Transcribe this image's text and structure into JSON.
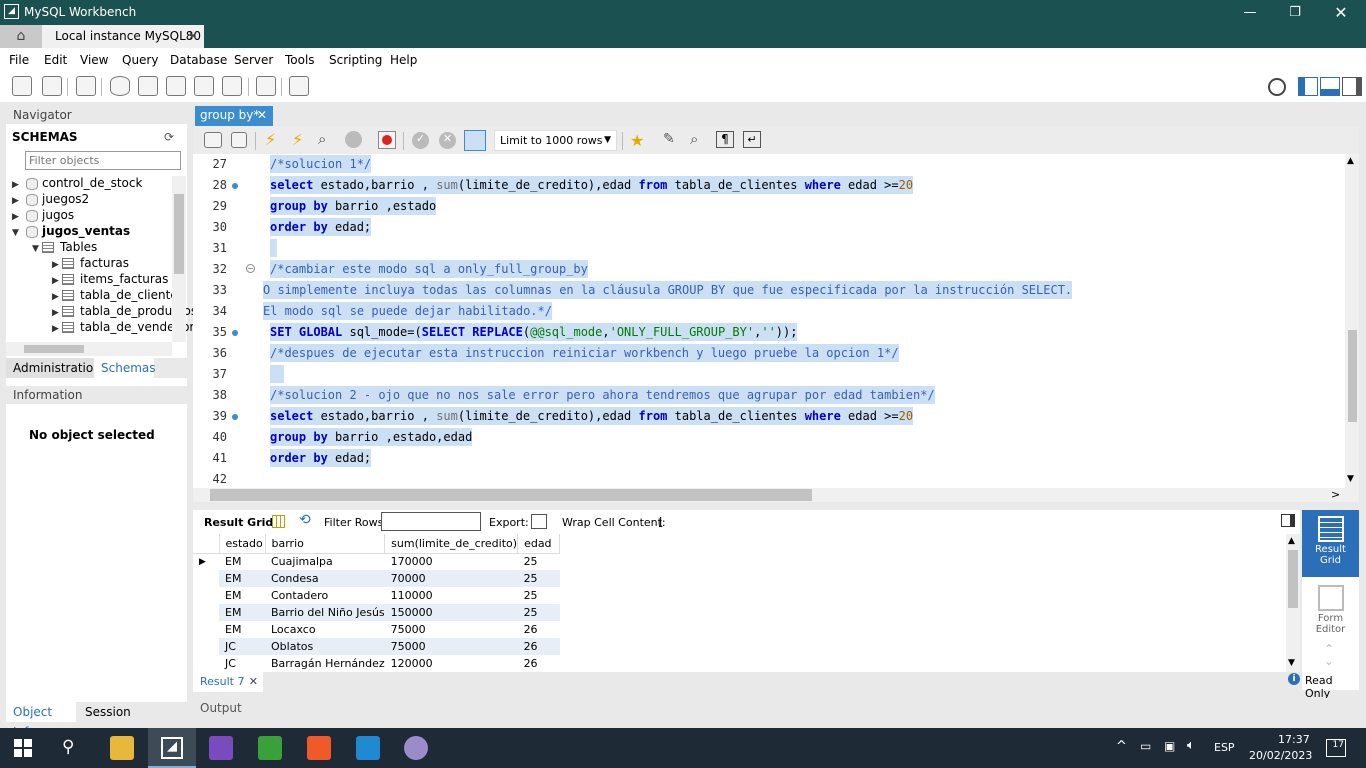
{
  "window": {
    "title": "MySQL Workbench",
    "tab": "Local instance MySQL80"
  },
  "menu": [
    "File",
    "Edit",
    "View",
    "Query",
    "Database",
    "Server",
    "Tools",
    "Scripting",
    "Help"
  ],
  "navigator": {
    "title": "Navigator",
    "schemas_label": "SCHEMAS",
    "filter_placeholder": "Filter objects",
    "schemas": [
      "control_de_stock",
      "juegos2",
      "jugos",
      "jugos_ventas"
    ],
    "tables_label": "Tables",
    "tables": [
      "facturas",
      "items_facturas",
      "tabla_de_clientes",
      "tabla_de_productos",
      "tabla_de_vendedores"
    ],
    "tab_admin": "Administration",
    "tab_schemas": "Schemas",
    "info_title": "Information",
    "no_object": "No object selected",
    "tab_objinfo": "Object Info",
    "tab_session": "Session"
  },
  "editor": {
    "tab": "group by*",
    "limit": "Limit to 1000 rows",
    "lines": [
      {
        "n": "27",
        "html": "<span class='cm'>/*solucion 1*/</span>"
      },
      {
        "n": "28",
        "dot": true,
        "html": "<span class='kw'>select</span> estado,barrio , <span class='fn'>sum</span>(limite_de_credito),edad <span class='kw'>from</span> tabla_de_clientes <span class='kw'>where</span> edad &gt;=<span class='num'>20</span>"
      },
      {
        "n": "29",
        "html": "<span class='kw'>group by</span> barrio ,estado"
      },
      {
        "n": "30",
        "html": "<span class='kw'>order by</span> edad;"
      },
      {
        "n": "31",
        "html": " "
      },
      {
        "n": "32",
        "html": "<span class='cm'>/*cambiar este modo sql a only_full_group_by</span>"
      },
      {
        "n": "33",
        "html": "<span class='cm'>O simplemente incluya todas las columnas en la cláusula GROUP BY que fue especificada por la instrucción SELECT.</span>",
        "indent": -7
      },
      {
        "n": "34",
        "html": "<span class='cm'>El modo sql se puede dejar habilitado.*/</span>",
        "indent": -7
      },
      {
        "n": "35",
        "dot": true,
        "html": "<span class='kw'>SET GLOBAL</span> sql_mode=(<span class='kw'>SELECT REPLACE</span>(<span class='str'>@@sql_mode</span>,<span class='str'>'ONLY_FULL_GROUP_BY'</span>,<span class='str'>''</span>));"
      },
      {
        "n": "36",
        "html": "<span class='cm'>/*despues de ejecutar esta instruccion reiniciar workbench y luego pruebe la opcion 1*/</span>"
      },
      {
        "n": "37",
        "html": "  "
      },
      {
        "n": "38",
        "html": "<span class='cm'>/*solucion 2 - ojo que no nos sale error pero ahora tendremos que agrupar por edad tambien*/</span>"
      },
      {
        "n": "39",
        "dot": true,
        "html": "<span class='kw'>select</span> estado,barrio , <span class='fn'>sum</span>(limite_de_credito),edad <span class='kw'>from</span> tabla_de_clientes <span class='kw'>where</span> edad &gt;=<span class='num'>20</span>"
      },
      {
        "n": "40",
        "html": "<span class='kw'>group by</span> barrio ,estado,edad"
      },
      {
        "n": "41",
        "html": "<span class='kw'>order by</span> edad;"
      },
      {
        "n": "42",
        "html": ""
      }
    ]
  },
  "result": {
    "grid_label": "Result Grid",
    "filter_label": "Filter Rows:",
    "export_label": "Export:",
    "wrap_label": "Wrap Cell Content:",
    "columns": [
      "estado",
      "barrio",
      "sum(limite_de_credito)",
      "edad"
    ],
    "rows": [
      [
        "EM",
        "Cuajimalpa",
        "170000",
        "25"
      ],
      [
        "EM",
        "Condesa",
        "70000",
        "25"
      ],
      [
        "EM",
        "Contadero",
        "110000",
        "25"
      ],
      [
        "EM",
        "Barrio del Niño Jesús",
        "150000",
        "25"
      ],
      [
        "EM",
        "Locaxco",
        "75000",
        "26"
      ],
      [
        "JC",
        "Oblatos",
        "75000",
        "26"
      ],
      [
        "JC",
        "Barragán Hernández",
        "120000",
        "26"
      ]
    ],
    "tab": "Result 7",
    "read_only": "Read Only",
    "side_result": "Result Grid",
    "side_form": "Form Editor"
  },
  "output_label": "Output",
  "taskbar": {
    "lang": "ESP",
    "time": "17:37",
    "date": "20/02/2023",
    "notif": "17"
  }
}
